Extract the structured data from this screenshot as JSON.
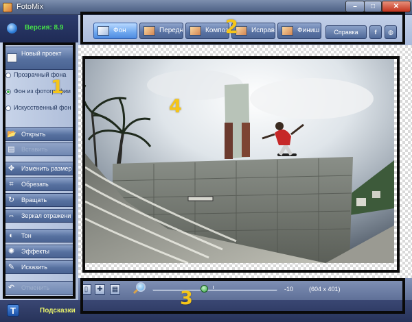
{
  "window": {
    "title": "FotoMix",
    "min": "–",
    "max": "□",
    "close": "✕"
  },
  "version": {
    "label": "Версия: 8.9"
  },
  "sidebar": {
    "new_project": "Новый проект",
    "radios": [
      {
        "label": "Прозрачный фона",
        "selected": false
      },
      {
        "label": "Фон из фотографии",
        "selected": true
      },
      {
        "label": "Искусственный фон",
        "selected": false
      }
    ],
    "buttons": [
      {
        "label": "Открыть",
        "icon": "folder-icon",
        "glyph": "📂",
        "disabled": false
      },
      {
        "label": "Вставить",
        "icon": "paste-icon",
        "glyph": "▤",
        "disabled": true
      },
      {
        "label": "Изменить размер",
        "icon": "resize-icon",
        "glyph": "✥",
        "disabled": false
      },
      {
        "label": "Обрезать",
        "icon": "crop-icon",
        "glyph": "⌗",
        "disabled": false
      },
      {
        "label": "Вращать",
        "icon": "rotate-icon",
        "glyph": "↻",
        "disabled": false
      },
      {
        "label": "Зеркал отражени",
        "icon": "mirror-icon",
        "glyph": "⇔",
        "disabled": false
      },
      {
        "label": "Тон",
        "icon": "tone-icon",
        "glyph": "◐",
        "disabled": false
      },
      {
        "label": "Эффекты",
        "icon": "effects-icon",
        "glyph": "✺",
        "disabled": false
      },
      {
        "label": "Исказить",
        "icon": "distort-icon",
        "glyph": "✎",
        "disabled": false
      },
      {
        "label": "Отменить",
        "icon": "undo-icon",
        "glyph": "↶",
        "disabled": true
      }
    ]
  },
  "toolbar": {
    "tabs": [
      {
        "label": "Фон",
        "active": true
      },
      {
        "label": "Передний",
        "active": false
      },
      {
        "label": "Композиция",
        "active": false
      },
      {
        "label": "Исправить",
        "active": false
      },
      {
        "label": "Финиш",
        "active": false
      }
    ],
    "help": "Справка",
    "facebook": "f",
    "web": "◍"
  },
  "zoom": {
    "value": "-10",
    "image_size": "(604 x 401)",
    "level": 0.42
  },
  "hints": {
    "label": "Подсказки",
    "icon": "T"
  },
  "annotations": [
    "1",
    "2",
    "3",
    "4"
  ]
}
